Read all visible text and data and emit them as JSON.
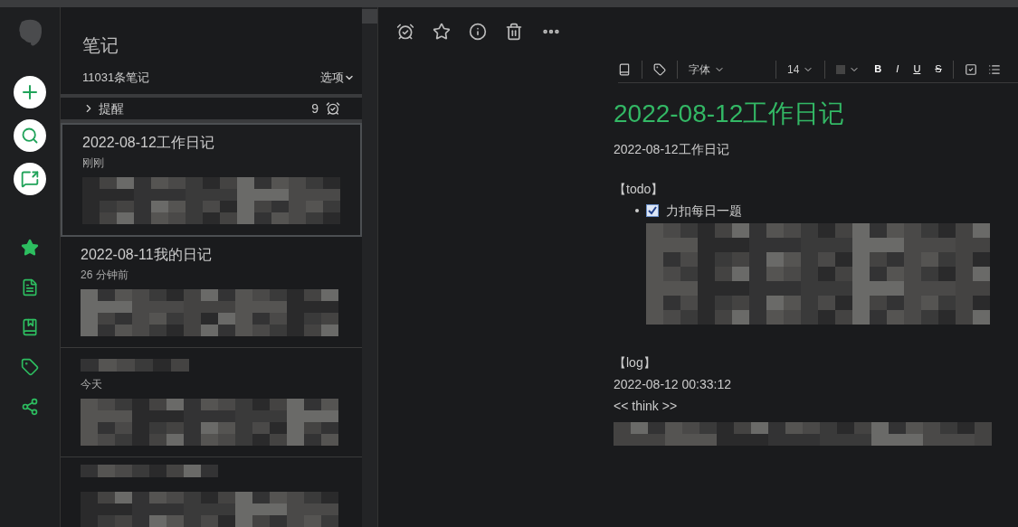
{
  "notes_panel": {
    "title": "笔记",
    "count": "11031条笔记",
    "options": "选项",
    "reminders": {
      "label": "提醒",
      "count": "9",
      "expanded": false
    },
    "notes": [
      {
        "title": "2022-08-12工作日记",
        "time": "刚刚",
        "selected": true
      },
      {
        "title": "2022-08-11我的日记",
        "time": "26 分钟前",
        "selected": false
      },
      {
        "time": "今天",
        "selected": false
      }
    ]
  },
  "editor": {
    "font": "字体",
    "size": "14",
    "format_buttons": [
      {
        "label": "B",
        "kind": "bold"
      },
      {
        "label": "I",
        "kind": "italic"
      },
      {
        "label": "U",
        "kind": "underline"
      },
      {
        "label": "S",
        "kind": "strike"
      }
    ],
    "note": {
      "title": "2022-08-12工作日记",
      "subtitle": "2022-08-12工作日记",
      "todo_heading": "【todo】",
      "todos": [
        {
          "text": "力扣每日一题",
          "checked": true
        }
      ],
      "log_heading": "【log】",
      "log_time": "2022-08-12 00:33:12",
      "think": "<< think >>"
    }
  }
}
